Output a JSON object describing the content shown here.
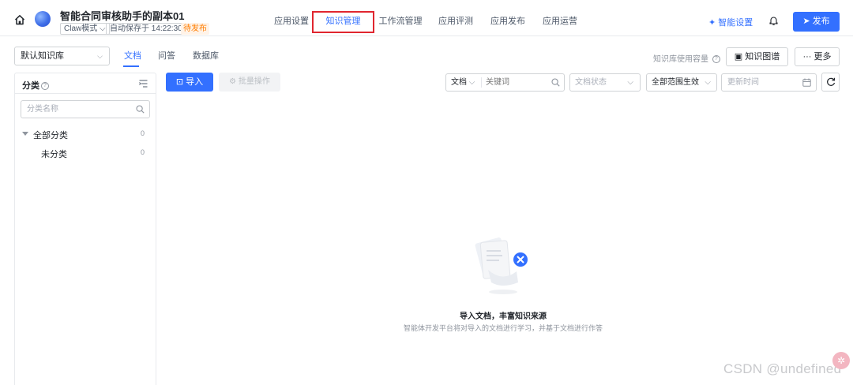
{
  "header": {
    "title": "智能合同审核助手的副本01",
    "mode": "Claw模式",
    "autosave": "自动保存于 14:22:30",
    "status": "待发布",
    "nav": [
      "应用设置",
      "知识管理",
      "工作流管理",
      "应用评测",
      "应用发布",
      "应用运营"
    ],
    "active_nav": "知识管理",
    "smart_setting": "智能设置",
    "publish": "发布"
  },
  "toolbar": {
    "kb_select": "默认知识库",
    "tabs": [
      "文档",
      "问答",
      "数据库"
    ],
    "active_tab": "文档",
    "capacity": "知识库使用容量",
    "graph": "知识图谱",
    "more": "··· 更多"
  },
  "sidebar": {
    "title": "分类",
    "search_placeholder": "分类名称",
    "tree": [
      {
        "label": "全部分类",
        "count": "0"
      },
      {
        "label": "未分类",
        "count": "0"
      }
    ]
  },
  "actions": {
    "import": "导入",
    "batch": "批量操作"
  },
  "filters": {
    "type": "文档",
    "keyword_placeholder": "关键词",
    "doc_status_placeholder": "文档状态",
    "scope": "全部范围生效",
    "update_time_placeholder": "更新时间"
  },
  "empty": {
    "title": "导入文档，丰富知识来源",
    "desc": "智能体开发平台将对导入的文档进行学习，并基于文档进行作答"
  },
  "watermark": "CSDN @undefined",
  "colors": {
    "accent": "#3370ff",
    "highlight_border": "#e0262f",
    "status_orange": "#ff7d00"
  }
}
